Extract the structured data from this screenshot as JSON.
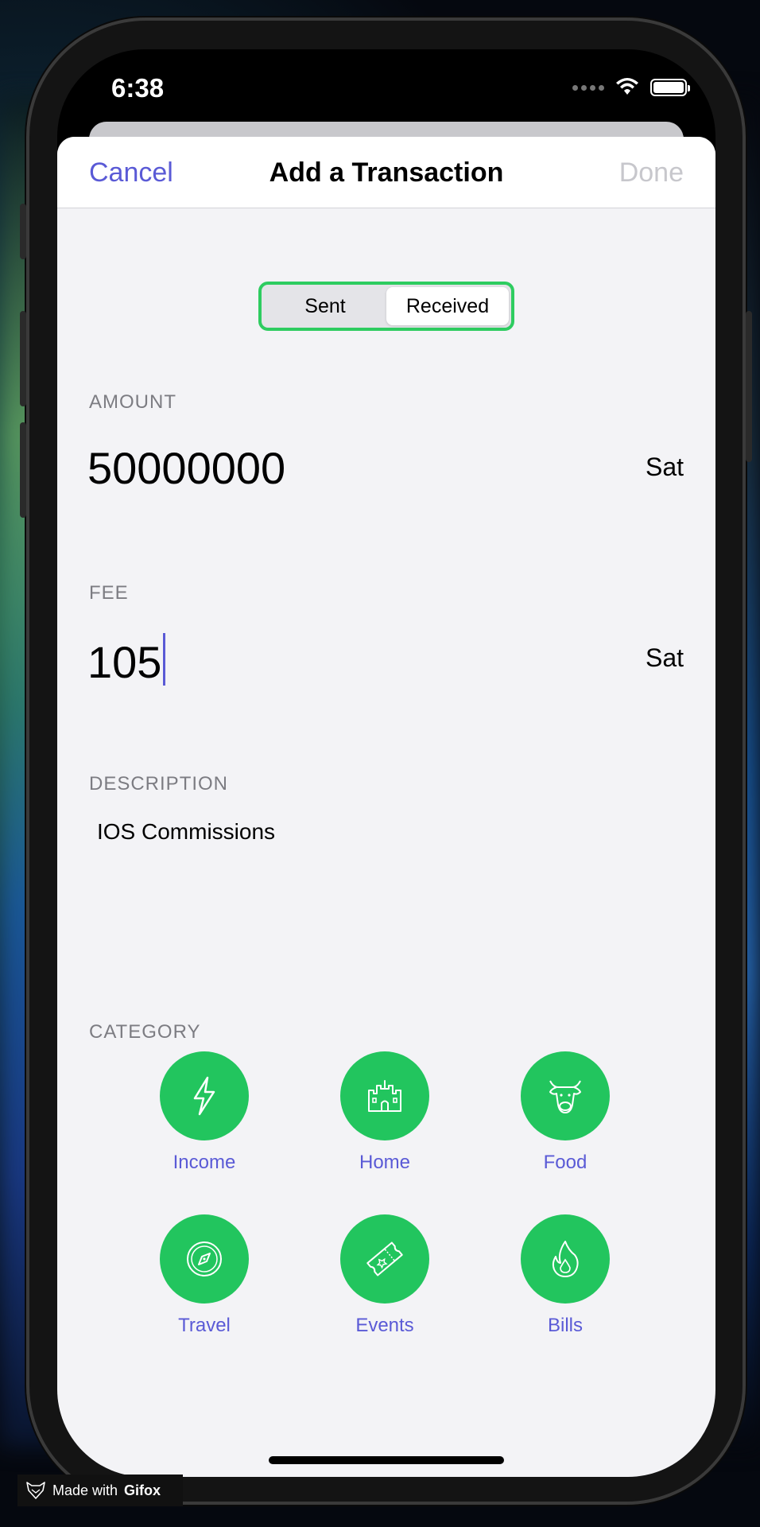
{
  "status_bar": {
    "time": "6:38"
  },
  "nav": {
    "cancel": "Cancel",
    "title": "Add a Transaction",
    "done": "Done"
  },
  "segmented": {
    "options": [
      "Sent",
      "Received"
    ],
    "selected": "Received"
  },
  "amount": {
    "label": "AMOUNT",
    "value": "50000000",
    "unit": "Sat"
  },
  "fee": {
    "label": "FEE",
    "value": "105",
    "unit": "Sat"
  },
  "description": {
    "label": "DESCRIPTION",
    "value": "IOS Commissions"
  },
  "category": {
    "label": "CATEGORY",
    "items": [
      {
        "label": "Income",
        "icon": "lightning-icon"
      },
      {
        "label": "Home",
        "icon": "castle-icon"
      },
      {
        "label": "Food",
        "icon": "cow-icon"
      },
      {
        "label": "Travel",
        "icon": "compass-icon"
      },
      {
        "label": "Events",
        "icon": "ticket-icon"
      },
      {
        "label": "Bills",
        "icon": "flame-icon"
      }
    ]
  },
  "watermark": {
    "prefix": "Made with",
    "brand": "Gifox"
  },
  "colors": {
    "accent": "#5a5ad6",
    "category_green": "#22c55e",
    "segment_border": "#2ecc60"
  }
}
